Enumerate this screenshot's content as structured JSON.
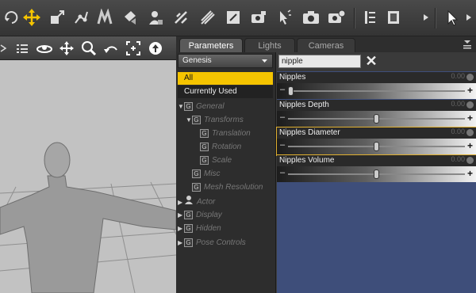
{
  "toolbar": {
    "icons": [
      "rotate-icon",
      "translate-icon",
      "scale-icon",
      "joint-editor-icon",
      "node-weight-icon",
      "surface-icon",
      "figure-icon",
      "geometry-editor-icon",
      "geometry-tool-icon",
      "region-nav-icon",
      "camera-render-icon",
      "spot-render-icon",
      "render-icon",
      "render-settings-icon",
      "layout-icon",
      "tool-settings-icon",
      "pointer-icon",
      "more-icon"
    ]
  },
  "viewport": {
    "icons": [
      "menu-icon",
      "orbit-icon",
      "pan-icon",
      "zoom-icon",
      "undo-camera-icon",
      "frame-icon",
      "up-icon"
    ]
  },
  "tabs": [
    {
      "label": "Parameters",
      "active": true
    },
    {
      "label": "Lights",
      "active": false
    },
    {
      "label": "Cameras",
      "active": false
    }
  ],
  "left": {
    "dropdown": "Genesis",
    "categories": [
      {
        "label": "All",
        "selected": true
      },
      {
        "label": "Currently Used",
        "selected": false
      }
    ],
    "tree": [
      {
        "label": "General",
        "level": 0,
        "expanded": true
      },
      {
        "label": "Transforms",
        "level": 1,
        "expanded": true
      },
      {
        "label": "Translation",
        "level": 2
      },
      {
        "label": "Rotation",
        "level": 2
      },
      {
        "label": "Scale",
        "level": 2
      },
      {
        "label": "Misc",
        "level": 1
      },
      {
        "label": "Mesh Resolution",
        "level": 1
      },
      {
        "label": "Actor",
        "level": 0,
        "expanded": false
      },
      {
        "label": "Display",
        "level": 0,
        "expanded": false
      },
      {
        "label": "Hidden",
        "level": 0,
        "expanded": false
      },
      {
        "label": "Pose Controls",
        "level": 0,
        "expanded": false
      }
    ]
  },
  "search": {
    "value": "nipple"
  },
  "params": [
    {
      "name": "Nipples",
      "value": "0.00",
      "level": 0.0,
      "selected": false
    },
    {
      "name": "Nipples Depth",
      "value": "0.00",
      "level": 0.5,
      "selected": false
    },
    {
      "name": "Nipples Diameter",
      "value": "0.00",
      "level": 0.5,
      "selected": true
    },
    {
      "name": "Nipples Volume",
      "value": "0.00",
      "level": 0.5,
      "selected": false
    }
  ],
  "colors": {
    "accent": "#f5c400",
    "selection": "#e0b030",
    "panel_bg": "#3e4e7a"
  }
}
